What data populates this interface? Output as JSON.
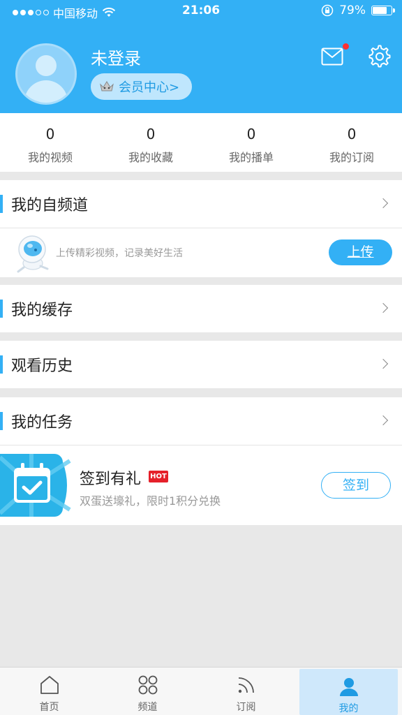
{
  "status_bar": {
    "carrier": "中国移动",
    "time": "21:06",
    "battery": "79%",
    "battery_level": 0.79
  },
  "profile": {
    "login_text": "未登录",
    "vip_label": "会员中心>"
  },
  "stats": [
    {
      "count": "0",
      "label": "我的视频"
    },
    {
      "count": "0",
      "label": "我的收藏"
    },
    {
      "count": "0",
      "label": "我的播单"
    },
    {
      "count": "0",
      "label": "我的订阅"
    }
  ],
  "channel": {
    "title": "我的自频道",
    "upload_hint": "上传精彩视频，记录美好生活",
    "upload_button": "上传"
  },
  "cache": {
    "title": "我的缓存"
  },
  "history": {
    "title": "观看历史"
  },
  "tasks": {
    "title": "我的任务",
    "task_title": "签到有礼",
    "hot_badge": "HOT",
    "task_subtitle": "双蛋送壕礼，限时1积分兑换",
    "sign_button": "签到"
  },
  "tabbar": [
    {
      "label": "首页",
      "icon": "home-icon"
    },
    {
      "label": "频道",
      "icon": "grid-icon"
    },
    {
      "label": "订阅",
      "icon": "rss-icon"
    },
    {
      "label": "我的",
      "icon": "user-icon",
      "active": true
    }
  ],
  "colors": {
    "accent": "#33b0f5",
    "hot": "#e5202a",
    "notification_dot": "#ff3030"
  }
}
